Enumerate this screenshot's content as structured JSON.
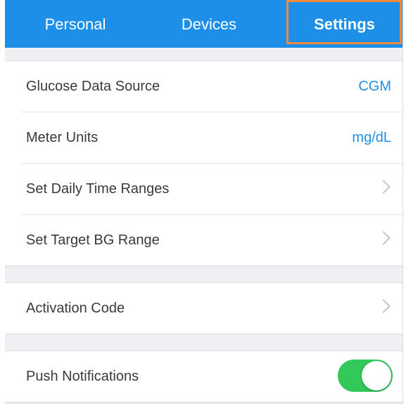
{
  "tabs": [
    {
      "label": "Personal"
    },
    {
      "label": "Devices"
    },
    {
      "label": "Settings",
      "selected": true
    }
  ],
  "settings": {
    "glucose_source": {
      "label": "Glucose Data Source",
      "value": "CGM"
    },
    "meter_units": {
      "label": "Meter Units",
      "value": "mg/dL"
    },
    "daily_ranges": {
      "label": "Set Daily Time Ranges"
    },
    "target_bg": {
      "label": "Set Target BG Range"
    },
    "activation_code": {
      "label": "Activation Code"
    },
    "push_notifications": {
      "label": "Push Notifications",
      "enabled": true
    }
  },
  "colors": {
    "accent": "#1e8fe8",
    "highlight": "#f08a3a",
    "toggle_on": "#33c85a"
  }
}
